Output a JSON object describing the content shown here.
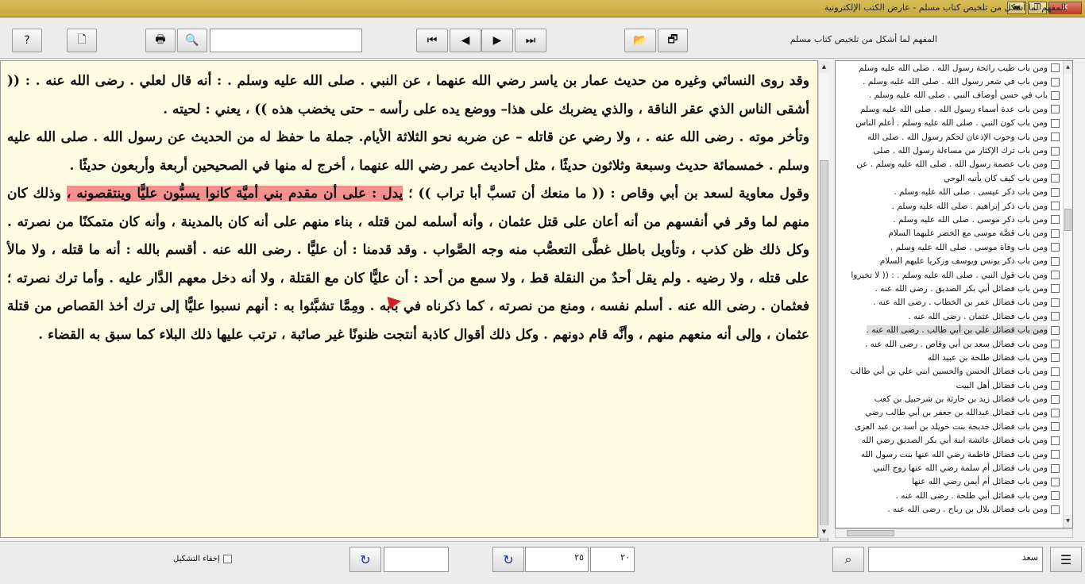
{
  "window": {
    "title": "المفهم لما أشكل من تلخيص كتاب مسلم - عارض الكتب الإلكترونية",
    "minimize": "▬",
    "restore": "❐",
    "close": "✕"
  },
  "toolbar": {
    "help_icon": "?",
    "new_doc_icon": "🗋",
    "print_icon": "🖶",
    "search_icon": "🔍",
    "search_value": "",
    "first_icon": "⏮",
    "prev_icon": "◀",
    "next_icon": "▶",
    "last_icon": "⏭",
    "open_icon": "📂",
    "layout_icon": "🗗",
    "book_name": "المفهم لما أشكل من تلخيص كتاب مسلم"
  },
  "content": {
    "paragraphs": [
      "وقد روى النسائي وغيره من حديث عمار بن ياسر رضي الله عنهما ، عن النبي . صلى الله عليه وسلم . : أنه قال لعلي . رضى الله عنه . : (( أشقى الناس الذي عقر الناقة ، والذي يضربك على هذا– ووضع يده على رأسه – حتى يخضب هذه )) ، يعني : لحيته .",
      "وتأخر موته . رضى الله عنه . ، ولا رضي عن قاتله – عن ضربه نحو الثلاثة الأيام. جملة ما حفظ له من الحديث عن رسول الله . صلى الله عليه وسلم . خمسمائة حديث وسبعة وثلاثون حديثًا ، مثل أحاديث عمر رضي الله عنهما ، أخرج له منها في الصحيحين أربعة وأربعون حديثًا ."
    ],
    "para3_before": "وقول معاوية لسعد بن أبي وقاص : (( ما منعك أن تسبَّ أبا تراب )) ؛ ",
    "para3_highlight": "يدل : على أن مقدم بني أميَّة كانوا يسبُّون عليًّا وينتقصونه ،",
    "para3_after": " وذلك كان منهم لما وقر في أنفسهم من أنه أعان على قتل عثمان ، وأنه أسلمه لمن قتله ، بناء منهم على أنه كان بالمدينة ، وأنه كان متمكنًا من نصرته . وكل ذلك ظن كذب ، وتأويل باطل غطَّى التعصُّب منه وجه الصَّواب . وقد قدمنا : أن عليًّا . رضى الله عنه . أقسم بالله : أنه ما قتله ، ولا مالأ على قتله ، ولا رضيه . ولم يقل أحدٌ من النقلة قط ، ولا سمع من أحد : أن عليًّا كان مع القتلة ، ولا أنه دخل معهم الدَّار عليه . وأما ترك نصرته ؛ فعثمان . رضى الله عنه . أسلم نفسه ، ومنع من نصرته ، كما ذكرناه في بابه . ومِمَّا تشبَّثوا به : أنهم نسبوا عليًّا إلى ترك أخذ القصاص من قتلة عثمان ، وإلى أنه منعهم منهم ، وأنَّه قام دونهم . وكل ذلك أقوال كاذبة أنتجت ظنونًا غير صائبة ، ترتب عليها ذلك البلاء كما سبق به القضاء ."
  },
  "sidebar": {
    "items": [
      {
        "label": "ومن باب طيب رائحة رسول الله . صلى الله عليه وسلم",
        "selected": false
      },
      {
        "label": "ومن باب في شعر رسول الله . صلى الله عليه وسلم .",
        "selected": false
      },
      {
        "label": "باب في حسن أوصاف النبي . صلى الله عليه وسلم .",
        "selected": false
      },
      {
        "label": "ومن باب عدة أسماء رسول الله . صلى الله عليه وسلم",
        "selected": false
      },
      {
        "label": "ومن باب كون النبي . صلى الله عليه وسلم . أعلم الناس",
        "selected": false
      },
      {
        "label": "ومن باب وجوب الإذعان لحكم رسول الله . صلى الله",
        "selected": false
      },
      {
        "label": "ومن باب ترك الإكثار من مساءلة رسول الله . صلى",
        "selected": false
      },
      {
        "label": "ومن باب عصمة رسول الله . صلى الله عليه وسلم . عن",
        "selected": false
      },
      {
        "label": "ومن باب كيف كان يأتيه الوحي",
        "selected": false
      },
      {
        "label": "ومن باب ذكر عيسى . صلى الله عليه وسلم .",
        "selected": false
      },
      {
        "label": "ومن باب ذكر إبراهيم . صلى الله عليه وسلم .",
        "selected": false
      },
      {
        "label": "ومن باب ذكر موسى . صلى الله عليه وسلم .",
        "selected": false
      },
      {
        "label": "ومن باب قصَّة موسى مع الخضر عليهما السلام",
        "selected": false
      },
      {
        "label": "ومن باب وفاة موسى . صلى الله عليه وسلم .",
        "selected": false
      },
      {
        "label": "ومن باب ذكر يونس ويوسف وزكريا عليهم السلام",
        "selected": false
      },
      {
        "label": "ومن باب قول النبي . صلى الله عليه وسلم . : (( لا تخيروا",
        "selected": false
      },
      {
        "label": "ومن باب فضائل أبي بكر الصديق . رضى الله عنه .",
        "selected": false
      },
      {
        "label": "ومن باب فضائل عمر بن الخطاب . رضى الله عنه .",
        "selected": false
      },
      {
        "label": "ومن باب فضائل عثمان . رضى الله عنه .",
        "selected": false
      },
      {
        "label": "ومن باب فضائل علي بن أبي طالب . رضى الله عنه .",
        "selected": true
      },
      {
        "label": "ومن باب فضائل سعد بن أبي وقاص . رضى الله عنه .",
        "selected": false
      },
      {
        "label": "ومن باب فضائل طلحة بن عبيد الله",
        "selected": false
      },
      {
        "label": "ومن باب فضائل الحسن والحسين ابني علي بن أبي طالب",
        "selected": false
      },
      {
        "label": "ومن باب فضائل أهل البيت",
        "selected": false
      },
      {
        "label": "ومن باب فضائل زيد بن حارثة بن شرحبيل بن كعب",
        "selected": false
      },
      {
        "label": "ومن باب فضائل عبدالله بن جعفر بن أبي طالب رضي",
        "selected": false
      },
      {
        "label": "ومن باب فضائل خديجة بنت خويلد بن أسد بن عبد العزى",
        "selected": false
      },
      {
        "label": "ومن باب فضائل عائشة ابنة أبي بكر الصديق رضي الله",
        "selected": false
      },
      {
        "label": "ومن باب فضائل فاطمة رضي الله عنها بنت رسول الله",
        "selected": false
      },
      {
        "label": "ومن باب فضائل أم سلمة رضي الله عنها زوج النبي",
        "selected": false
      },
      {
        "label": "ومن باب فضائل أم أيمن رضي الله عنها",
        "selected": false
      },
      {
        "label": "ومن باب فضائل أبي طلحة . رضى الله عنه .",
        "selected": false
      },
      {
        "label": "ومن باب فضائل بلال بن رباح . رضى الله عنه .",
        "selected": false
      }
    ]
  },
  "statusbar": {
    "hide_tashkeel_label": "إخفاء التشكيل",
    "refresh_icon_1": "↻",
    "goto_value": "",
    "refresh_icon_2": "↻",
    "page_value": "٢٥",
    "part_value": "٢٠",
    "binoculars_icon": "⌕",
    "search_field_value": "سعد",
    "list_icon": "☰"
  },
  "colors": {
    "title_bar": "#d2b44c",
    "content_bg": "#fefbe3",
    "highlight": "#f4908e",
    "marker": "#d42020"
  }
}
